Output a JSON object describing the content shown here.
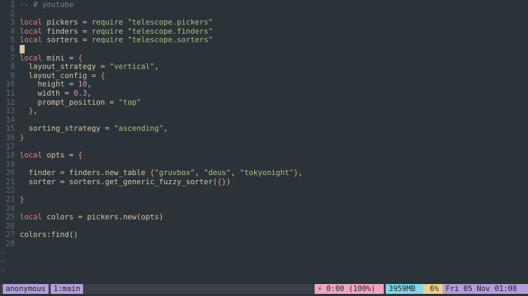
{
  "editor": {
    "lines": [
      {
        "n": "1",
        "tokens": [
          {
            "t": "-- # youtube",
            "c": "comment"
          }
        ]
      },
      {
        "n": "2",
        "tokens": []
      },
      {
        "n": "3",
        "tokens": [
          {
            "t": "local",
            "c": "kw"
          },
          {
            "t": " pickers = ",
            "c": "ident"
          },
          {
            "t": "require",
            "c": "fn"
          },
          {
            "t": " ",
            "c": "ident"
          },
          {
            "t": "\"telescope.pickers\"",
            "c": "str"
          }
        ]
      },
      {
        "n": "4",
        "tokens": [
          {
            "t": "local",
            "c": "kw"
          },
          {
            "t": " finders = ",
            "c": "ident"
          },
          {
            "t": "require",
            "c": "fn"
          },
          {
            "t": " ",
            "c": "ident"
          },
          {
            "t": "\"telescope.finders\"",
            "c": "str"
          }
        ]
      },
      {
        "n": "5",
        "tokens": [
          {
            "t": "local",
            "c": "kw"
          },
          {
            "t": " sorters = ",
            "c": "ident"
          },
          {
            "t": "require",
            "c": "fn"
          },
          {
            "t": " ",
            "c": "ident"
          },
          {
            "t": "\"telescope.sorters\"",
            "c": "str"
          }
        ]
      },
      {
        "n": "6",
        "tokens": [],
        "cursor": true
      },
      {
        "n": "7",
        "tokens": [
          {
            "t": "local",
            "c": "kw"
          },
          {
            "t": " mini = ",
            "c": "ident"
          },
          {
            "t": "{",
            "c": "brace"
          }
        ]
      },
      {
        "n": "8",
        "tokens": [
          {
            "t": "  layout_strategy = ",
            "c": "ident"
          },
          {
            "t": "\"vertical\"",
            "c": "str"
          },
          {
            "t": ",",
            "c": "ident"
          }
        ]
      },
      {
        "n": "9",
        "tokens": [
          {
            "t": "  layout_config = ",
            "c": "ident"
          },
          {
            "t": "{",
            "c": "brace"
          }
        ]
      },
      {
        "n": "10",
        "tokens": [
          {
            "t": "    height = ",
            "c": "ident"
          },
          {
            "t": "10",
            "c": "num"
          },
          {
            "t": ",",
            "c": "ident"
          }
        ]
      },
      {
        "n": "11",
        "tokens": [
          {
            "t": "    width = ",
            "c": "ident"
          },
          {
            "t": "0.3",
            "c": "num"
          },
          {
            "t": ",",
            "c": "ident"
          }
        ]
      },
      {
        "n": "12",
        "tokens": [
          {
            "t": "    prompt_position = ",
            "c": "ident"
          },
          {
            "t": "\"top\"",
            "c": "str"
          }
        ]
      },
      {
        "n": "13",
        "tokens": [
          {
            "t": "  ",
            "c": "ident"
          },
          {
            "t": "}",
            "c": "brace"
          },
          {
            "t": ",",
            "c": "ident"
          }
        ]
      },
      {
        "n": "14",
        "tokens": []
      },
      {
        "n": "15",
        "tokens": [
          {
            "t": "  sorting_strategy = ",
            "c": "ident"
          },
          {
            "t": "\"ascending\"",
            "c": "str"
          },
          {
            "t": ",",
            "c": "ident"
          }
        ]
      },
      {
        "n": "16",
        "tokens": [
          {
            "t": "}",
            "c": "brace"
          }
        ]
      },
      {
        "n": "17",
        "tokens": []
      },
      {
        "n": "18",
        "tokens": [
          {
            "t": "local",
            "c": "kw"
          },
          {
            "t": " opts = ",
            "c": "ident"
          },
          {
            "t": "{",
            "c": "brace"
          }
        ]
      },
      {
        "n": "19",
        "tokens": []
      },
      {
        "n": "20",
        "tokens": [
          {
            "t": "  finder = finders.new_table ",
            "c": "ident"
          },
          {
            "t": "{",
            "c": "brace"
          },
          {
            "t": "\"gruvbox\"",
            "c": "str"
          },
          {
            "t": ", ",
            "c": "ident"
          },
          {
            "t": "\"deus\"",
            "c": "str"
          },
          {
            "t": ", ",
            "c": "ident"
          },
          {
            "t": "\"tokyonight\"",
            "c": "str"
          },
          {
            "t": "}",
            "c": "brace"
          },
          {
            "t": ",",
            "c": "ident"
          }
        ]
      },
      {
        "n": "21",
        "tokens": [
          {
            "t": "  sorter = sorters.get_generic_fuzzy_sorter(",
            "c": "ident"
          },
          {
            "t": "{}",
            "c": "brace"
          },
          {
            "t": ")",
            "c": "ident"
          }
        ]
      },
      {
        "n": "22",
        "tokens": []
      },
      {
        "n": "23",
        "tokens": [
          {
            "t": "}",
            "c": "brace"
          }
        ]
      },
      {
        "n": "24",
        "tokens": []
      },
      {
        "n": "25",
        "tokens": [
          {
            "t": "local",
            "c": "kw"
          },
          {
            "t": " colors = pickers.new(opts)",
            "c": "ident"
          }
        ]
      },
      {
        "n": "26",
        "tokens": []
      },
      {
        "n": "27",
        "tokens": [
          {
            "t": "colors:find()",
            "c": "ident"
          }
        ]
      },
      {
        "n": "28",
        "tokens": []
      }
    ],
    "tildes": [
      "~",
      "~",
      "~"
    ]
  },
  "statusbar": {
    "session": "anonymous",
    "window": "1:main",
    "battery": "⚡ 0:00 (100%)",
    "memory": "3959MB",
    "cpu": "6%",
    "clock": "Fri 05 Nov 01:08"
  },
  "colors": {
    "background": "#2b3339",
    "keyword": "#e67e80",
    "string": "#a7c080",
    "number": "#d699b6",
    "brace": "#e69875",
    "session_bg": "#b39ddb",
    "battery_bg": "#f3a6c2",
    "memory_bg": "#80d8ea",
    "cpu_bg": "#f0d08a"
  }
}
